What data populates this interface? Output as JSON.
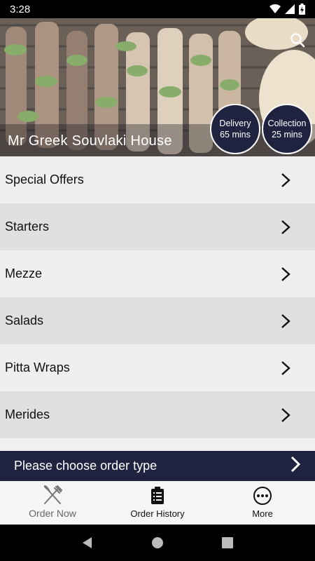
{
  "status_bar": {
    "time": "3:28"
  },
  "header": {
    "restaurant_name": "Mr Greek Souvlaki House",
    "delivery": {
      "label": "Delivery",
      "time": "65 mins"
    },
    "collection": {
      "label": "Collection",
      "time": "25 mins"
    }
  },
  "menu": {
    "items": [
      {
        "label": "Special Offers"
      },
      {
        "label": "Starters"
      },
      {
        "label": "Mezze"
      },
      {
        "label": "Salads"
      },
      {
        "label": "Pitta Wraps"
      },
      {
        "label": "Merides"
      }
    ]
  },
  "order_bar": {
    "label": "Please choose order type"
  },
  "tabs": [
    {
      "label": "Order Now",
      "icon": "fork-knife-icon"
    },
    {
      "label": "Order History",
      "icon": "clipboard-icon"
    },
    {
      "label": "More",
      "icon": "more-icon"
    }
  ],
  "colors": {
    "brand_navy": "#1f2340",
    "row_light": "#efefef",
    "row_dark": "#e0e0e0"
  }
}
